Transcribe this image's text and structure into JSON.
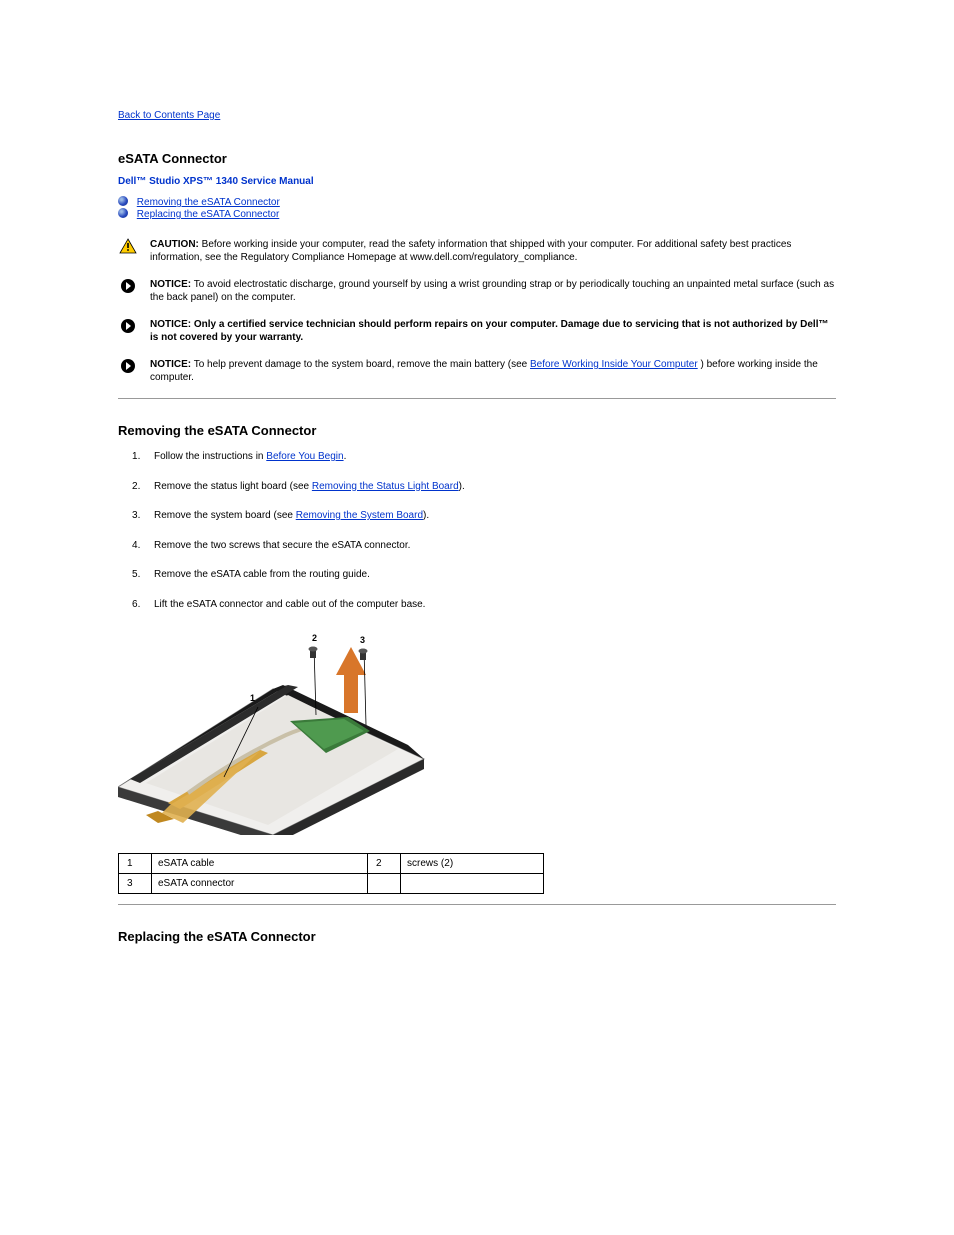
{
  "back_link": "Back to Contents Page",
  "page_title": "eSATA Connector",
  "subtitle": "Dell™ Studio XPS™ 1340 Service Manual",
  "toc": [
    {
      "label": "Removing the eSATA Connector"
    },
    {
      "label": "Replacing the eSATA Connector"
    }
  ],
  "notices": {
    "caution": {
      "label": "CAUTION:",
      "text": "Before working inside your computer, read the safety information that shipped with your computer. For additional safety best practices information, see the Regulatory Compliance Homepage at www.dell.com/regulatory_compliance."
    },
    "notice1": {
      "label": "NOTICE:",
      "text": "To avoid electrostatic discharge, ground yourself by using a wrist grounding strap or by periodically touching an unpainted metal surface (such as the back panel) on the computer."
    },
    "notice2": {
      "label": "NOTICE:",
      "text": "Only a certified service technician should perform repairs on your computer. Damage due to servicing that is not authorized by Dell™ is not covered by your warranty."
    },
    "notice3": {
      "label": "NOTICE:",
      "text_before": "To help prevent damage to the system board, remove the main battery (see ",
      "link": "Before Working Inside Your Computer",
      "text_after": ") before working inside the computer."
    }
  },
  "section1": {
    "title": "Removing the eSATA Connector",
    "steps": {
      "s1": {
        "pre": "Follow the instructions in ",
        "link": "Before You Begin",
        "post": "."
      },
      "s2": {
        "pre": "Remove the status light board (see ",
        "link": "Removing the Status Light Board",
        "post": ")."
      },
      "s3": {
        "pre": "Remove the system board (see ",
        "link": "Removing the System Board",
        "post": ")."
      },
      "s4": {
        "text": "Remove the two screws that secure the eSATA connector."
      },
      "s5": {
        "text": "Remove the eSATA cable from the routing guide."
      },
      "s6": {
        "text": "Lift the eSATA connector and cable out of the computer base."
      }
    }
  },
  "image_callouts": {
    "c1": "1",
    "c2": "2",
    "c3": "3"
  },
  "parts_table": {
    "r1c1n": "1",
    "r1c1t": "eSATA cable",
    "r1c2n": "2",
    "r1c2t": "screws (2)",
    "r2c1n": "3",
    "r2c1t": "eSATA connector",
    "r2c2n": "",
    "r2c2t": ""
  },
  "section2": {
    "title": "Replacing the eSATA Connector"
  }
}
